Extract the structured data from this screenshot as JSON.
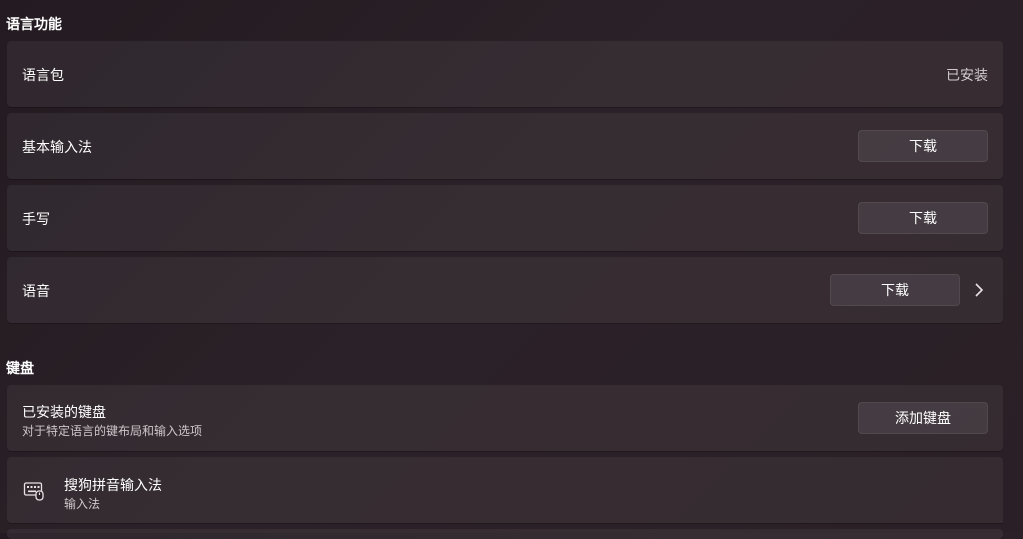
{
  "language_features": {
    "title": "语言功能",
    "language_pack": {
      "label": "语言包",
      "status": "已安装"
    },
    "basic_typing": {
      "label": "基本输入法",
      "button": "下载"
    },
    "handwriting": {
      "label": "手写",
      "button": "下载"
    },
    "speech": {
      "label": "语音",
      "button": "下载"
    }
  },
  "keyboard": {
    "title": "键盘",
    "installed": {
      "label": "已安装的键盘",
      "description": "对于特定语言的键布局和输入选项",
      "button": "添加键盘"
    },
    "items": [
      {
        "name": "搜狗拼音输入法",
        "type": "输入法",
        "icon": "keyboard-icon"
      }
    ]
  }
}
